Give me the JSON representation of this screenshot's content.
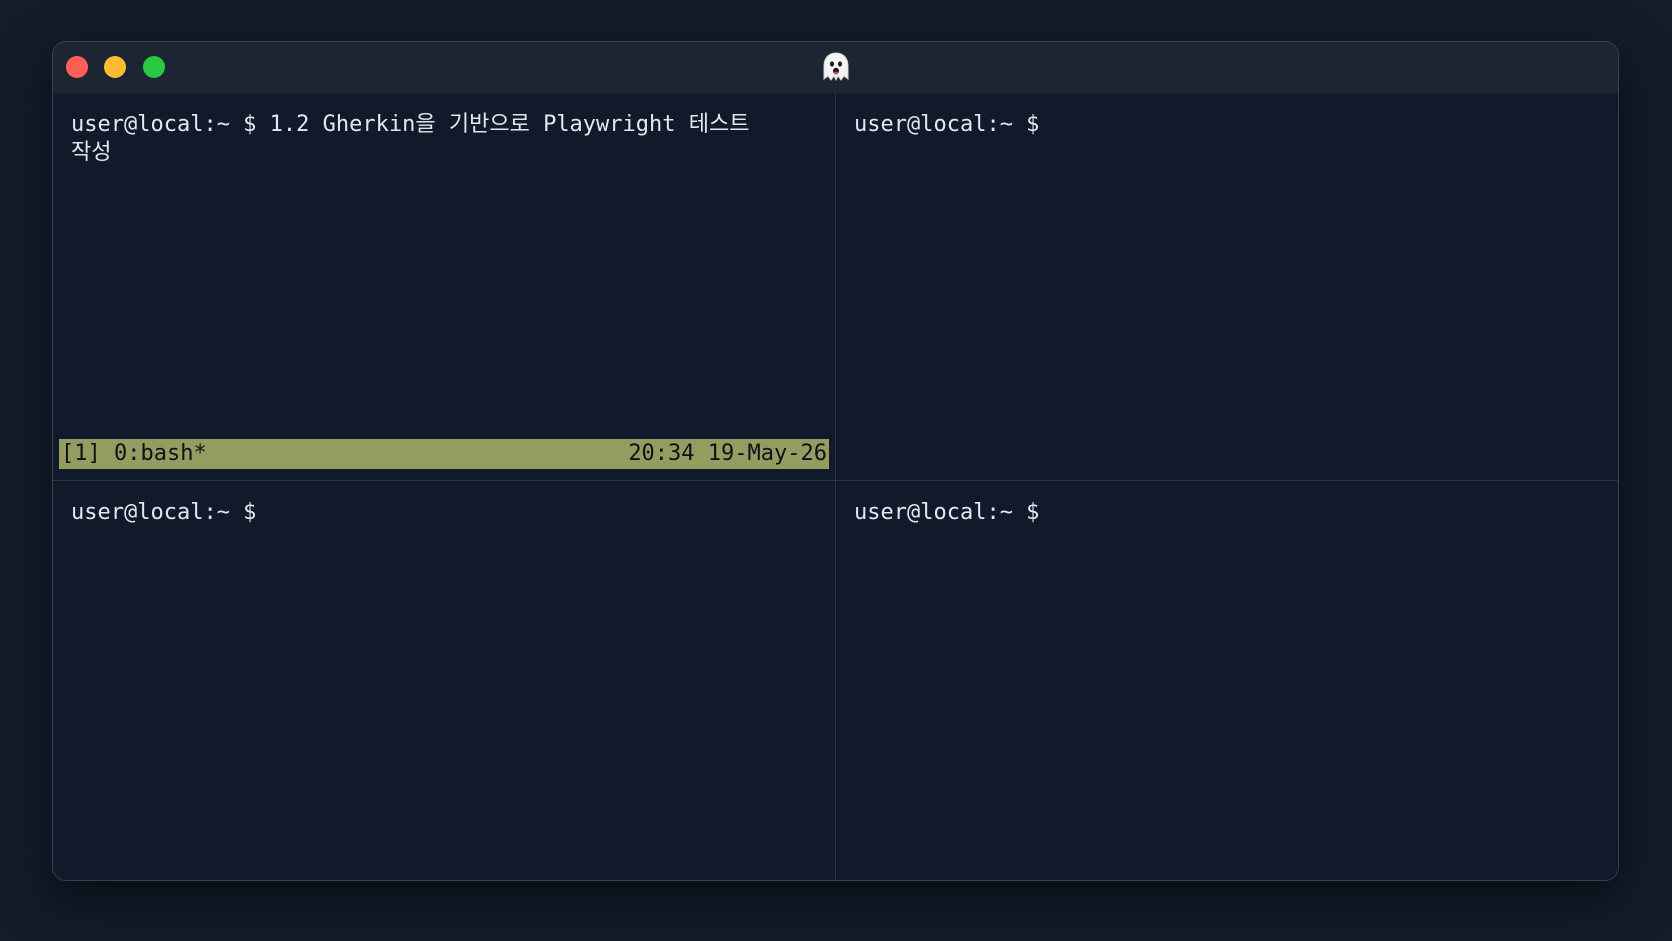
{
  "window": {
    "title_icon": "ghost-icon",
    "controls": {
      "close_color": "#fe5f57",
      "minimize_color": "#febc2e",
      "zoom_color": "#28c840"
    }
  },
  "panes": {
    "top_left": {
      "prompt": "user@local:~ $",
      "command": " 1.2 Gherkin을 기반으로 Playwright 테스트 작성"
    },
    "top_right": {
      "prompt": "user@local:~ $"
    },
    "bottom_left": {
      "prompt": "user@local:~ $"
    },
    "bottom_right": {
      "prompt": "user@local:~ $"
    }
  },
  "tmux_status": {
    "left": "[1] 0:bash*",
    "right": "20:34 19-May-26",
    "background": "#949d5f"
  }
}
